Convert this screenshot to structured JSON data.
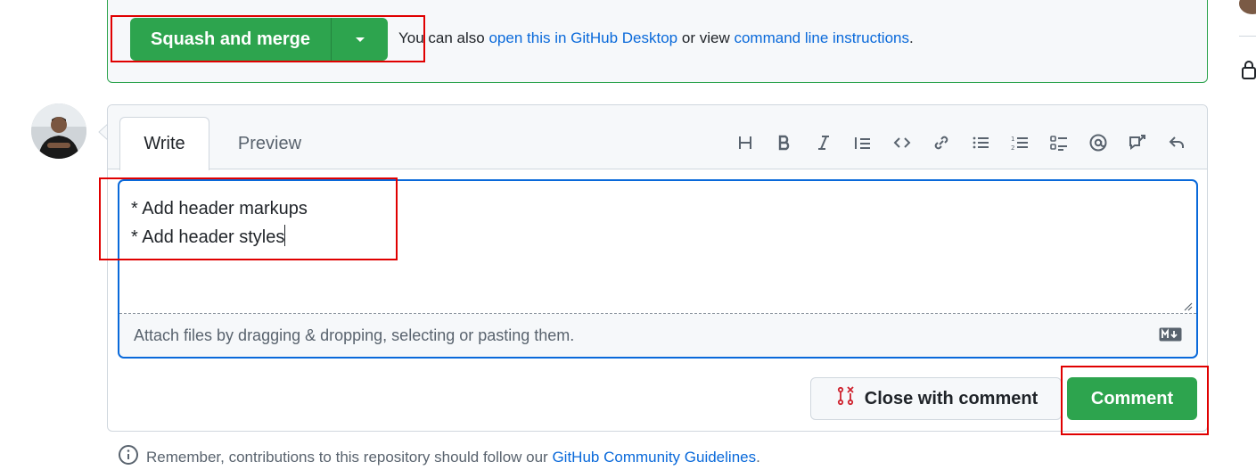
{
  "merge": {
    "button_label": "Squash and merge",
    "text_prefix": "You can also",
    "link_desktop": "open this in GitHub Desktop",
    "text_middle": "or view",
    "link_cli": "command line instructions",
    "text_suffix": ".",
    "accent_color": "#2da44e"
  },
  "comment": {
    "tabs": [
      {
        "label": "Write",
        "active": true
      },
      {
        "label": "Preview",
        "active": false
      }
    ],
    "toolbar_icons": [
      "heading-icon",
      "bold-icon",
      "italic-icon",
      "quote-icon",
      "code-icon",
      "link-icon",
      "unordered-list-icon",
      "ordered-list-icon",
      "task-list-icon",
      "mention-icon",
      "cross-reference-icon",
      "saved-reply-icon"
    ],
    "editor_lines": [
      "* Add header markups",
      "* Add header styles"
    ],
    "attach_hint": "Attach files by dragging & dropping, selecting or pasting them.",
    "close_button": "Close with comment",
    "comment_button": "Comment"
  },
  "footer": {
    "text": "Remember, contributions to this repository should follow our",
    "link": "GitHub Community Guidelines",
    "suffix": "."
  },
  "colors": {
    "primary_green": "#2da44e",
    "link_blue": "#0969da",
    "highlight_red": "#e00000",
    "focus_blue": "#0969da"
  }
}
